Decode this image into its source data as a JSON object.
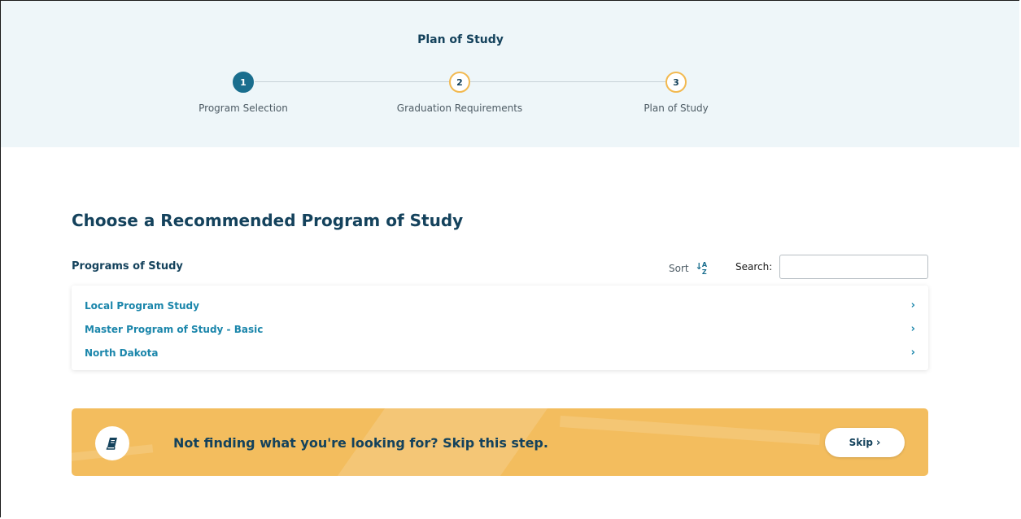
{
  "header": {
    "title": "Plan of Study",
    "steps": [
      {
        "number": "1",
        "label": "Program Selection",
        "state": "active"
      },
      {
        "number": "2",
        "label": "Graduation Requirements",
        "state": "pending"
      },
      {
        "number": "3",
        "label": "Plan of Study",
        "state": "pending"
      }
    ]
  },
  "main": {
    "title": "Choose a Recommended Program of Study",
    "list_heading": "Programs of Study",
    "sort_label": "Sort",
    "sort_icon": "sort-alpha-icon",
    "search_label": "Search:",
    "search_value": "",
    "programs": [
      {
        "name": "Local Program Study"
      },
      {
        "name": "Master Program of Study - Basic"
      },
      {
        "name": "North Dakota"
      }
    ]
  },
  "banner": {
    "icon": "book-icon",
    "text": "Not finding what you're looking for? Skip this step.",
    "skip_label": "Skip"
  },
  "colors": {
    "primary": "#14425c",
    "link": "#1b86ab",
    "active_step": "#1a6e8e",
    "accent": "#f3bd5e",
    "header_bg": "#eef6f9"
  }
}
